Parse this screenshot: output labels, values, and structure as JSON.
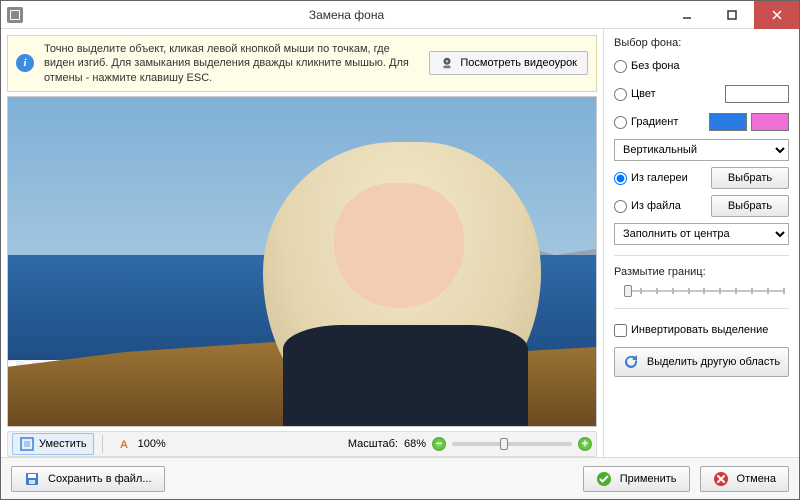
{
  "window": {
    "title": "Замена фона"
  },
  "hint": {
    "text": "Точно выделите объект, кликая левой кнопкой мыши по точкам, где виден изгиб. Для замыкания выделения дважды кликните мышью. Для отмены - нажмите клавишу ESC.",
    "video_btn": "Посмотреть видеоурок"
  },
  "status": {
    "fit_label": "Уместить",
    "zoom_100": "100%",
    "scale_label": "Масштаб:",
    "scale_value": "68%",
    "scale_pos_pct": 40
  },
  "panel": {
    "heading": "Выбор фона:",
    "opts": {
      "none": "Без фона",
      "color": "Цвет",
      "gradient": "Градиент",
      "gallery": "Из галереи",
      "file": "Из файла"
    },
    "selected": "gallery",
    "grad_direction": "Вертикальный",
    "choose_btn": "Выбрать",
    "fill_mode": "Заполнить от центра",
    "blur_heading": "Размытие границ:",
    "blur_pos_pct": 6,
    "invert_label": "Инвертировать выделение",
    "invert_checked": false,
    "reselect_btn": "Выделить другую область",
    "colors": {
      "color_swatch": "#ffffff",
      "grad_a": "#2a7be4",
      "grad_b": "#f06fd6"
    }
  },
  "footer": {
    "save_btn": "Сохранить в файл...",
    "apply_btn": "Применить",
    "cancel_btn": "Отмена"
  }
}
